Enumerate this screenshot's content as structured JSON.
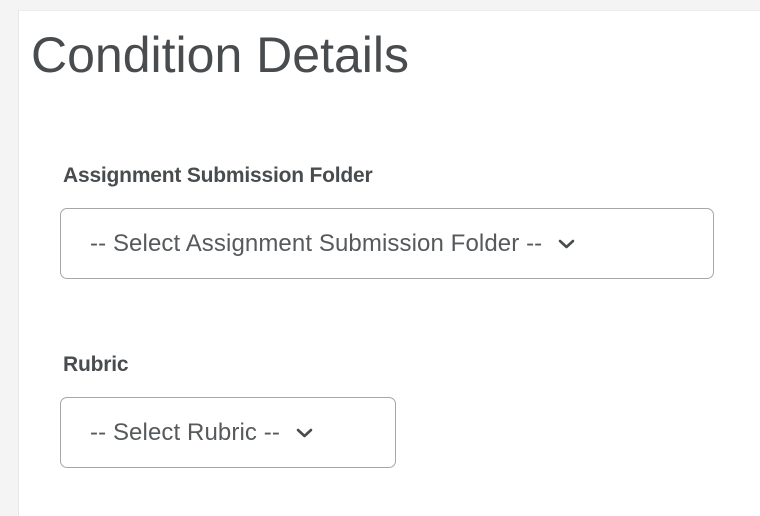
{
  "condition_details": {
    "title": "Condition Details",
    "assignment_folder": {
      "label": "Assignment Submission Folder",
      "selected": "-- Select Assignment Submission Folder --",
      "icon": "chevron-down-icon"
    },
    "rubric": {
      "label": "Rubric",
      "selected": "-- Select Rubric --",
      "icon": "chevron-down-icon"
    }
  },
  "colors": {
    "text": "#494c4e",
    "border": "#a5a8ab",
    "background": "#ffffff"
  }
}
